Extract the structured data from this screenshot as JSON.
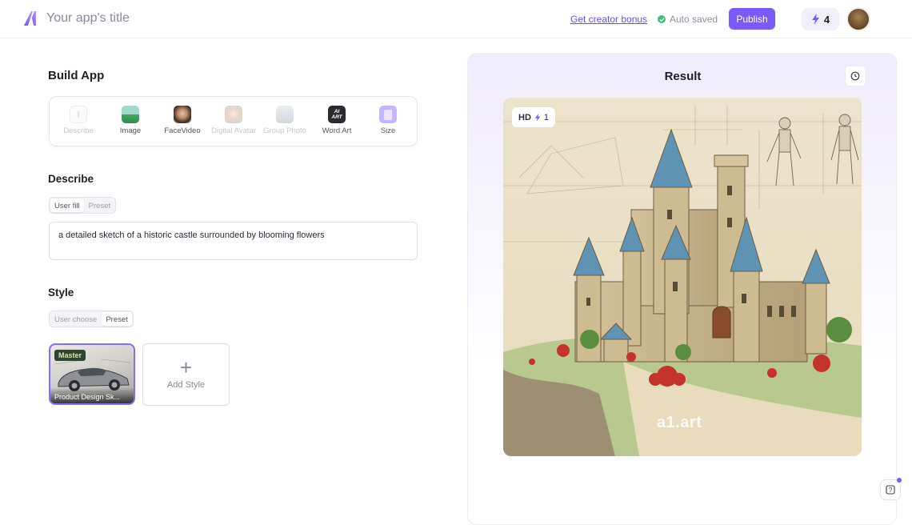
{
  "header": {
    "app_title": "Your app's title",
    "bonus_link": "Get creator bonus",
    "autosave_status": "Auto saved",
    "publish_label": "Publish",
    "credits": "4",
    "accent_color": "#7a5af8"
  },
  "build": {
    "title": "Build App",
    "tools": [
      {
        "label": "Describe",
        "icon": "text-cursor-icon",
        "enabled": false
      },
      {
        "label": "Image",
        "icon": "image-icon",
        "enabled": true
      },
      {
        "label": "FaceVideo",
        "icon": "face-video-icon",
        "enabled": true
      },
      {
        "label": "Digital Avatar",
        "icon": "digital-avatar-icon",
        "enabled": false
      },
      {
        "label": "Group Photo",
        "icon": "group-photo-icon",
        "enabled": false
      },
      {
        "label": "Word Art",
        "icon": "word-art-icon",
        "enabled": true
      },
      {
        "label": "Size",
        "icon": "size-icon",
        "enabled": true
      }
    ],
    "word_art_icon_text": "AI\nART"
  },
  "describe": {
    "title": "Describe",
    "toggle": [
      "User fill",
      "Preset"
    ],
    "active_toggle": "User fill",
    "prompt": "a detailed sketch of a historic castle surrounded by blooming flowers"
  },
  "style": {
    "title": "Style",
    "toggle": [
      "User choose",
      "Preset"
    ],
    "active_toggle": "Preset",
    "selected_style": {
      "badge": "Master",
      "name": "Product Design Sk..."
    },
    "add_label": "Add Style"
  },
  "result": {
    "title": "Result",
    "hd_label": "HD",
    "hd_cost": "1",
    "watermark": "a1.art"
  }
}
